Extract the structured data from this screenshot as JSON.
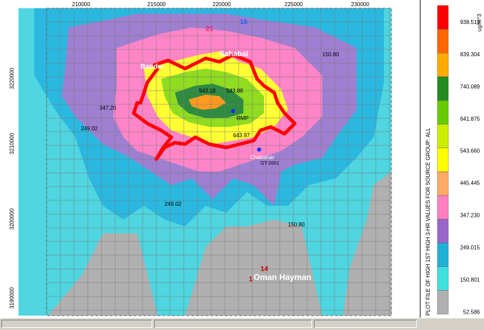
{
  "plot": {
    "x_ticks": [
      "210000",
      "215000",
      "220000",
      "225000",
      "230000"
    ],
    "y_ticks": [
      "3220000",
      "3210000",
      "3200000",
      "3190000"
    ],
    "contour_labels": [
      "943.18",
      "543.88",
      "347.20",
      "249.02",
      "150.80",
      "643.97",
      "249.02",
      "150.80"
    ],
    "source_labels": [
      "Sahabal",
      "Bandar",
      "RMP",
      "Chabahar",
      "GT-2001",
      "Oman Hayman"
    ]
  },
  "legend": {
    "title": "PLOT FILE OF HIGH 1ST HIGH 3-HR VALUES FOR SOURCE GROUP: ALL",
    "units": "ug/m^3",
    "levels": [
      "938.519",
      "839.304",
      "740.089",
      "641.875",
      "543.660",
      "445.445",
      "347.230",
      "249.015",
      "150.801",
      "52.586"
    ],
    "colors": [
      "#ff0000",
      "#ff6600",
      "#ffaa00",
      "#228b22",
      "#66cc00",
      "#ccee00",
      "#ffff00",
      "#ffaa66",
      "#ff80c0",
      "#9966cc",
      "#20b0d8",
      "#40e0e0",
      "#b0b0b0"
    ]
  },
  "status": {
    "pane1": "",
    "pane2": "",
    "pane3": ""
  }
}
